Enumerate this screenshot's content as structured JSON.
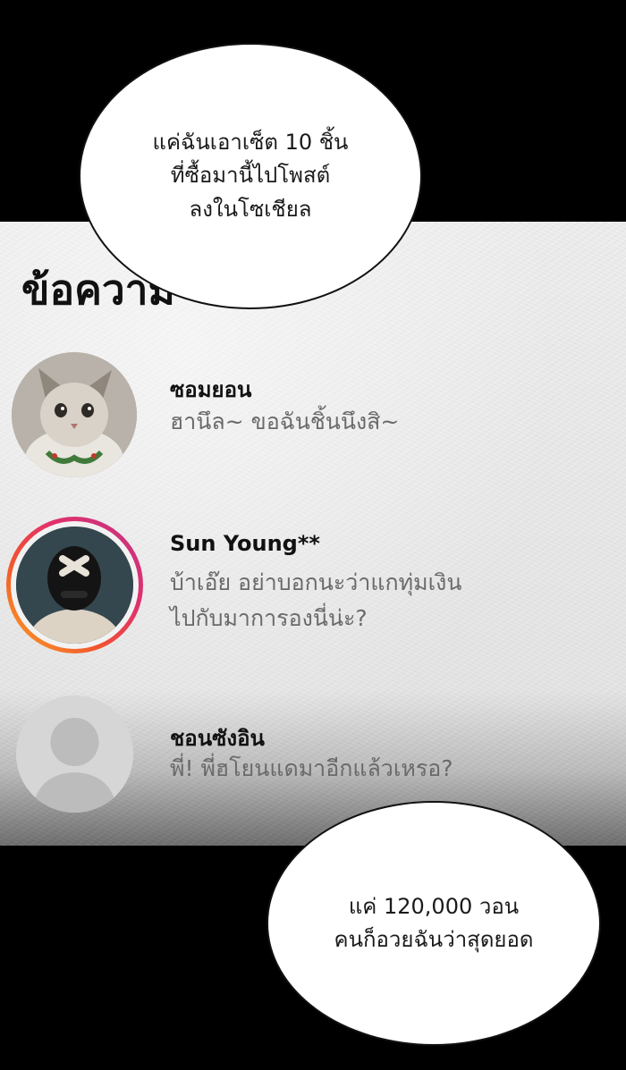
{
  "heading": "ข้อความ",
  "bubbles": {
    "top": [
      "แค่ฉันเอาเซ็ต 10 ชิ้น",
      "ที่ซื้อมานี้ไปโพสต์",
      "ลงในโซเชียล"
    ],
    "bottom": [
      "แค่ 120,000 วอน",
      "คนก็อวยฉันว่าสุดยอด"
    ]
  },
  "messages": [
    {
      "sender": "ซอมยอน",
      "preview": [
        "ฮานึล~ ขอฉันชิ้นนึงสิ~"
      ],
      "avatar_icon": "cat-photo-icon"
    },
    {
      "sender": "Sun Young**",
      "preview": [
        "บ้าเอ๊ย อย่าบอกนะว่าแกทุ่มเงิน",
        "ไปกับมาการองนี่น่ะ?"
      ],
      "avatar_icon": "masked-person-photo-icon",
      "story_ring_colors": [
        "#f9a825",
        "#f2542d",
        "#e1306c",
        "#c13584"
      ]
    },
    {
      "sender": "ชอนซังอิน",
      "preview": [
        "พี่! พี่ฮโยนแดมาอีกแล้วเหรอ?"
      ],
      "avatar_icon": "default-user-silhouette-icon"
    }
  ],
  "colors": {
    "background": "#000000",
    "paper": "#ececec",
    "sender_text": "#111111",
    "preview_text": "#6a6a6a"
  }
}
